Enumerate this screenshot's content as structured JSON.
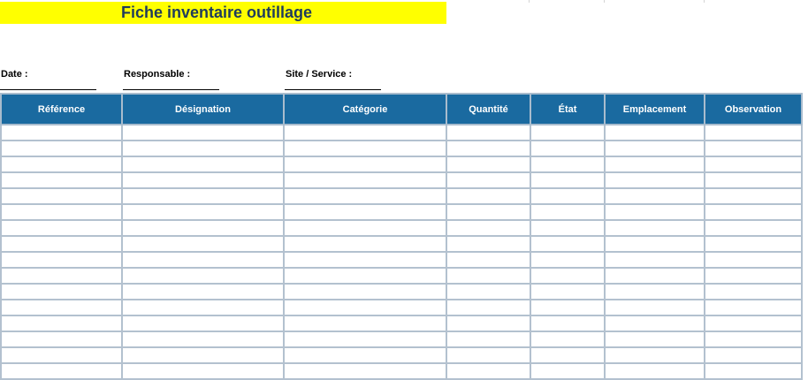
{
  "sheet": {
    "title": "Fiche inventaire outillage",
    "fields": {
      "date_label": "Date :",
      "responsable_label": "Responsable :",
      "site_label": "Site / Service :"
    },
    "title_band_color": "#ffff00",
    "header_color": "#1a6aa0"
  },
  "table": {
    "columns": [
      "Référence",
      "Désignation",
      "Catégorie",
      "Quantité",
      "État",
      "Emplacement",
      "Observation"
    ],
    "rows": [
      [
        "",
        "",
        "",
        "",
        "",
        "",
        ""
      ],
      [
        "",
        "",
        "",
        "",
        "",
        "",
        ""
      ],
      [
        "",
        "",
        "",
        "",
        "",
        "",
        ""
      ],
      [
        "",
        "",
        "",
        "",
        "",
        "",
        ""
      ],
      [
        "",
        "",
        "",
        "",
        "",
        "",
        ""
      ],
      [
        "",
        "",
        "",
        "",
        "",
        "",
        ""
      ],
      [
        "",
        "",
        "",
        "",
        "",
        "",
        ""
      ],
      [
        "",
        "",
        "",
        "",
        "",
        "",
        ""
      ],
      [
        "",
        "",
        "",
        "",
        "",
        "",
        ""
      ],
      [
        "",
        "",
        "",
        "",
        "",
        "",
        ""
      ],
      [
        "",
        "",
        "",
        "",
        "",
        "",
        ""
      ],
      [
        "",
        "",
        "",
        "",
        "",
        "",
        ""
      ],
      [
        "",
        "",
        "",
        "",
        "",
        "",
        ""
      ],
      [
        "",
        "",
        "",
        "",
        "",
        "",
        ""
      ],
      [
        "",
        "",
        "",
        "",
        "",
        "",
        ""
      ],
      [
        "",
        "",
        "",
        "",
        "",
        "",
        ""
      ]
    ]
  }
}
